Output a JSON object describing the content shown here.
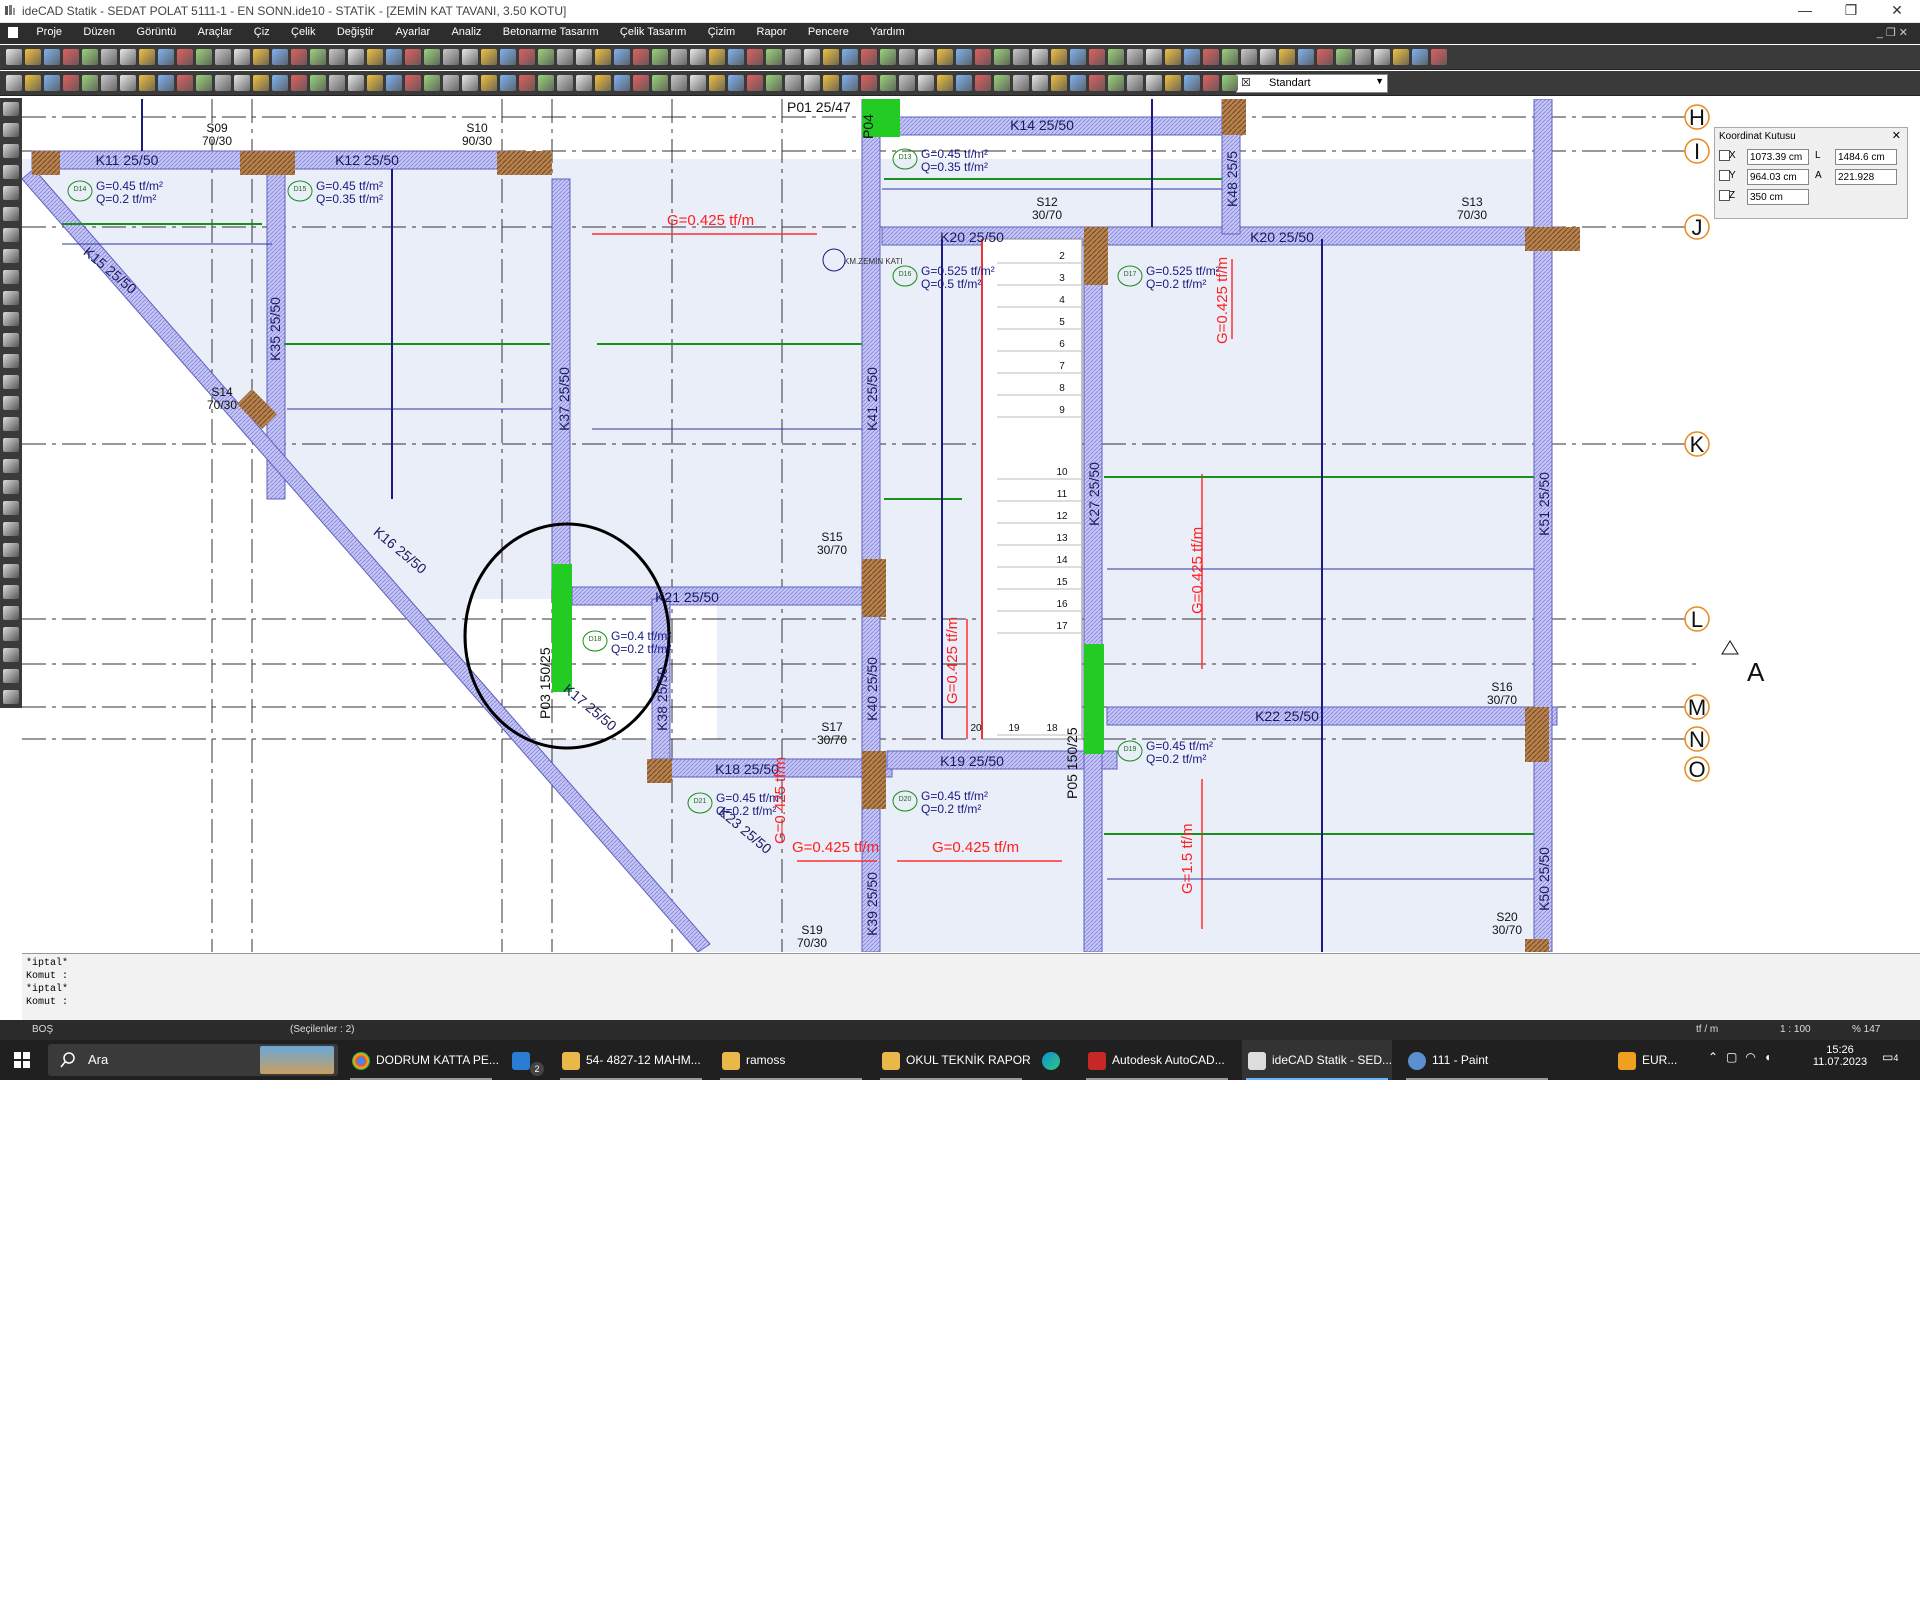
{
  "window": {
    "title": "ideCAD Statik - SEDAT POLAT 5111-1 - EN SONN.ide10 - STATİK - [ZEMİN KAT TAVANI,  3.50 KOTU]",
    "min": "—",
    "max": "❐",
    "close": "✕"
  },
  "menu": [
    "Proje",
    "Düzen",
    "Görüntü",
    "Araçlar",
    "Çiz",
    "Çelik",
    "Değiştir",
    "Ayarlar",
    "Analiz",
    "Betonarme Tasarım",
    "Çelik Tasarım",
    "Çizim",
    "Rapor",
    "Pencere",
    "Yardım"
  ],
  "toolbar2": {
    "style_select": "Standart"
  },
  "coord_box": {
    "title": "Koordinat Kutusu",
    "x_label": "X",
    "x_value": "1073.39 cm",
    "y_label": "Y",
    "y_value": "964.03 cm",
    "z_label": "Z",
    "z_value": "350 cm",
    "l_label": "L",
    "l_value": "1484.6 cm",
    "a_label": "A",
    "a_value": "221.928"
  },
  "grid_labels": [
    "H",
    "I",
    "J",
    "K",
    "L",
    "M",
    "N",
    "O"
  ],
  "section_label": "A",
  "drawing": {
    "beams": [
      "K11 25/50",
      "K12 25/50",
      "K14 25/50",
      "K20 25/50",
      "K20 25/50",
      "K21 25/50",
      "K22 25/50",
      "K18 25/50",
      "K19 25/50",
      "K15 25/50",
      "K16 25/50",
      "K17 25/50",
      "K23 25/50",
      "K35 25/50",
      "K37 25/50",
      "K38 25/50",
      "K40 25/50",
      "K41 25/50",
      "K27 25/50",
      "K48 25/5",
      "K51 25/50",
      "K50 25/50",
      "K39 25/50"
    ],
    "columns": [
      "S09\n70/30",
      "S10\n90/30",
      "S12\n30/70",
      "S13\n70/30",
      "S14\n70/30",
      "S15\n30/70",
      "S16\n30/70",
      "S17\n30/70",
      "S19\n70/30",
      "S20\n30/70"
    ],
    "walls": [
      "P01 25/47",
      "P03 150/25",
      "P04",
      "P05 150/25"
    ],
    "slab_loads": [
      {
        "id": "D14",
        "g": "G=0.45 tf/m²",
        "q": "Q=0.2 tf/m²"
      },
      {
        "id": "D15",
        "g": "G=0.45 tf/m²",
        "q": "Q=0.35 tf/m²"
      },
      {
        "id": "D13",
        "g": "G=0.45 tf/m²",
        "q": "Q=0.35 tf/m²"
      },
      {
        "id": "D16",
        "g": "G=0.525 tf/m²",
        "q": "Q=0.5 tf/m²"
      },
      {
        "id": "D17",
        "g": "G=0.525 tf/m²",
        "q": "Q=0.2 tf/m²"
      },
      {
        "id": "D18",
        "g": "G=0.4 tf/m²",
        "q": "Q=0.2 tf/m²"
      },
      {
        "id": "D19",
        "g": "G=0.45 tf/m²",
        "q": "Q=0.2 tf/m²"
      },
      {
        "id": "D20",
        "g": "G=0.45 tf/m²",
        "q": "Q=0.2 tf/m²"
      },
      {
        "id": "D21",
        "g": "G=0.45 tf/m²",
        "q": "Q=0.2 tf/m²"
      }
    ],
    "line_loads": [
      "G=0.425 tf/m",
      "G=0.425 tf/m",
      "G=0.425 tf/m",
      "G=0.425 tf/m",
      "G=0.425 tf/m",
      "G=0.425 tf/m",
      "G=1.5 tf/m",
      "G=0.425 tf/m"
    ],
    "stair_steps": [
      "2",
      "3",
      "4",
      "5",
      "6",
      "7",
      "8",
      "9",
      "10",
      "11",
      "12",
      "13",
      "14",
      "15",
      "16",
      "17",
      "18",
      "19",
      "20"
    ],
    "level_label": "KM.ZEMİN KATI"
  },
  "command": [
    "*iptal*",
    "Komut :",
    "*iptal*",
    "Komut :"
  ],
  "status": {
    "mode": "BOŞ",
    "selection": "(Seçilenler : 2)",
    "unit": "tf / m",
    "scale": "1 : 100",
    "zoom": "% 147"
  },
  "taskbar": {
    "search": "Ara",
    "items": [
      "DODRUM KATTA PE...",
      "54- 4827-12 MAHM...",
      "ramoss",
      "OKUL TEKNİK RAPOR",
      "Autodesk AutoCAD...",
      "ideCAD Statik - SED...",
      "111 - Paint"
    ],
    "mail_badge": "2",
    "weather": "EUR...",
    "time": "15:26",
    "date": "11.07.2023",
    "notif": "4"
  }
}
